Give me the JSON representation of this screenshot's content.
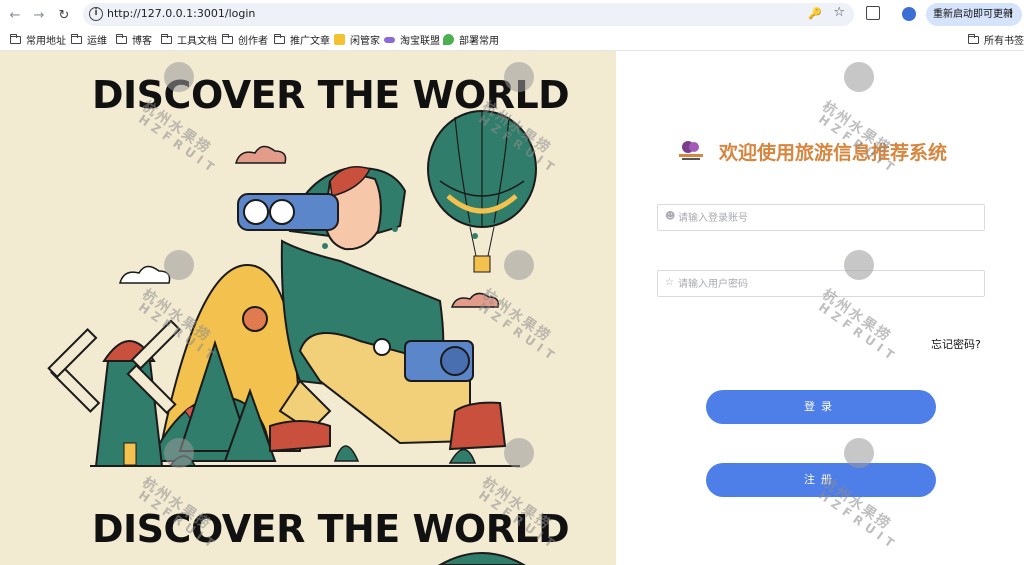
{
  "browser": {
    "url": "http://127.0.0.1:3001/login",
    "update_button": "重新启动即可更新",
    "bookmarks": [
      "常用地址",
      "运维",
      "博客",
      "工具文档",
      "创作者",
      "推广文章",
      "闲管家",
      "淘宝联盟",
      "部署常用"
    ],
    "all_bookmarks": "所有书签"
  },
  "hero": {
    "title_top": "DISCOVER THE WORLD",
    "title_bottom": "DISCOVER THE WORLD"
  },
  "login": {
    "title": "欢迎使用旅游信息推荐系统",
    "username_placeholder": "请输入登录账号",
    "password_placeholder": "请输入用户密码",
    "forgot": "忘记密码?",
    "login_button": "登录",
    "register_button": "注册"
  },
  "watermark": {
    "text": "杭州水果捞",
    "sub": "HZFRUIT"
  },
  "colors": {
    "accent": "#4e7ee8",
    "title": "#d7863f",
    "hero_bg": "#f3ead2"
  }
}
